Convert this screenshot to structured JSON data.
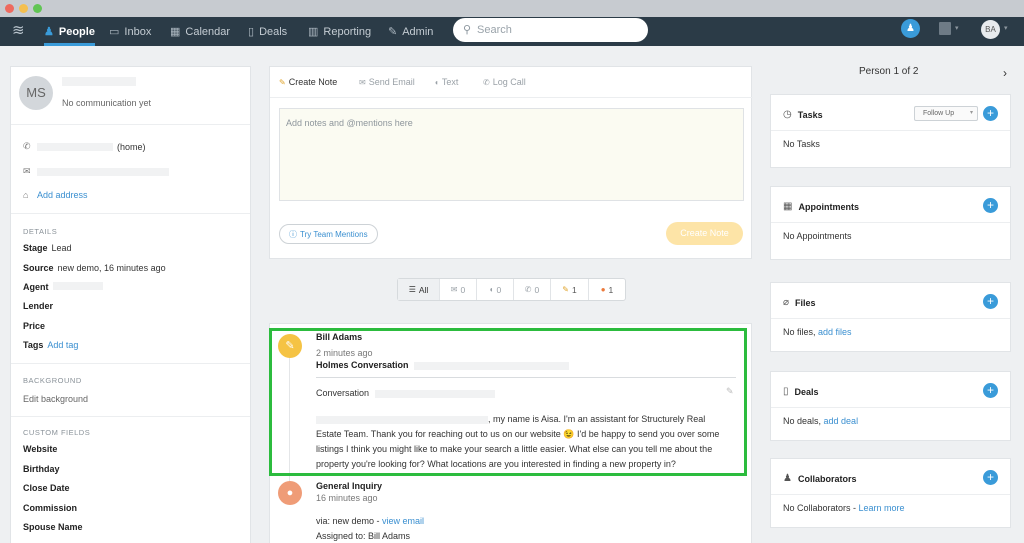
{
  "nav": {
    "items": [
      {
        "label": "People",
        "icon": "person-icon"
      },
      {
        "label": "Inbox",
        "icon": "inbox-icon"
      },
      {
        "label": "Calendar",
        "icon": "calendar-icon"
      },
      {
        "label": "Deals",
        "icon": "deals-icon"
      },
      {
        "label": "Reporting",
        "icon": "reporting-icon"
      },
      {
        "label": "Admin",
        "icon": "wrench-icon"
      }
    ],
    "search_placeholder": "Search",
    "user_initials": "BA"
  },
  "contact": {
    "initials": "MS",
    "status": "No communication yet",
    "phone_type": "(home)",
    "add_address": "Add address",
    "details_heading": "DETAILS",
    "stage_label": "Stage",
    "stage_value": "Lead",
    "source_label": "Source",
    "source_value": "new demo, 16 minutes ago",
    "agent_label": "Agent",
    "lender_label": "Lender",
    "price_label": "Price",
    "tags_label": "Tags",
    "add_tag": "Add tag",
    "background_heading": "BACKGROUND",
    "edit_background": "Edit background",
    "custom_heading": "CUSTOM FIELDS",
    "custom_fields": [
      "Website",
      "Birthday",
      "Close Date",
      "Commission",
      "Spouse Name"
    ]
  },
  "composer": {
    "tabs": [
      "Create Note",
      "Send Email",
      "Text",
      "Log Call"
    ],
    "note_placeholder": "Add notes and @mentions here",
    "try_mentions": "Try Team Mentions",
    "create_note": "Create Note"
  },
  "filters": {
    "all": "All",
    "email_count": "0",
    "text_count": "0",
    "call_count": "0",
    "note_count": "1",
    "conversation_count": "1"
  },
  "feed": {
    "item1": {
      "author": "Bill Adams",
      "time": "2 minutes ago",
      "title": "Holmes Conversation",
      "conversation_label": "Conversation",
      "message_a": ", my name is Aisa. I'm an assistant for Structurely Real Estate Team. Thank you for reaching out to us on our website 😉  I'd be happy to send you over some listings I think you might like to make your search a little easier. What else can you tell me about the property you're looking for? What locations are you interested in finding a new property in?"
    },
    "item2": {
      "title": "General Inquiry",
      "time": "16 minutes ago",
      "via": "via: new demo - ",
      "view_email": "view email",
      "assigned": "Assigned to: Bill Adams"
    }
  },
  "right": {
    "person_of": "Person 1 of 2",
    "tasks": {
      "title": "Tasks",
      "follow_up": "Follow Up",
      "empty": "No Tasks"
    },
    "appointments": {
      "title": "Appointments",
      "empty": "No Appointments"
    },
    "files": {
      "title": "Files",
      "empty": "No files, ",
      "add": "add files"
    },
    "deals": {
      "title": "Deals",
      "empty": "No deals, ",
      "add": "add deal"
    },
    "collaborators": {
      "title": "Collaborators",
      "empty": "No Collaborators - ",
      "learn": "Learn more"
    }
  },
  "colors": {
    "nav_bg": "#2b3b47",
    "accent": "#3a9bd9",
    "highlight": "#2cbc3e",
    "note_yellow": "#f5c344"
  }
}
